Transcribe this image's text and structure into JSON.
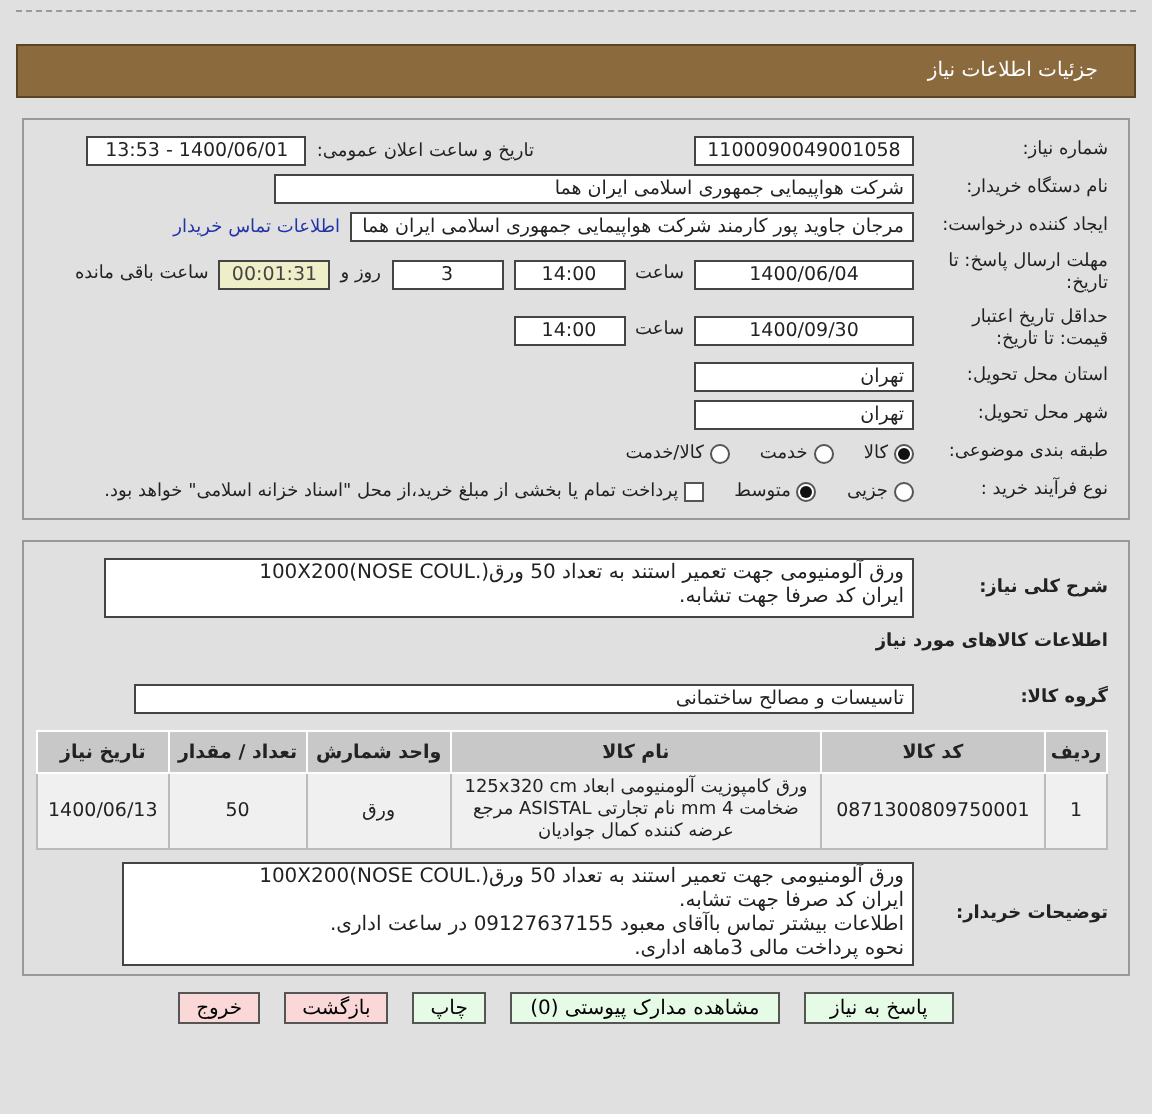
{
  "header": {
    "title": "جزئیات اطلاعات نیاز"
  },
  "need_number": {
    "label": "شماره نیاز:",
    "value": "1100090049001058"
  },
  "announce": {
    "label": "تاريخ و ساعت اعلان عمومی:",
    "value": "1400/06/01 - 13:53"
  },
  "buyer": {
    "label": "نام دستگاه خریدار:",
    "value": "شرکت هواپیمایی جمهوری اسلامی ایران هما"
  },
  "creator": {
    "label": "ایجاد کننده درخواست:",
    "value": "مرجان جاوید پور کارمند شرکت هواپیمایی جمهوری اسلامی ایران هما",
    "link": "اطلاعات تماس خریدار"
  },
  "deadline": {
    "label": "مهلت ارسال پاسخ: تا تاریخ:",
    "date": "1400/06/04",
    "time_label": "ساعت",
    "time": "14:00",
    "days": "3",
    "days_label": "روز و",
    "remaining": "00:01:31",
    "remaining_label": "ساعت باقی مانده"
  },
  "validity": {
    "label": "حداقل تاریخ اعتبار قیمت: تا تاریخ:",
    "date": "1400/09/30",
    "time_label": "ساعت",
    "time": "14:00"
  },
  "province": {
    "label": "استان محل تحویل:",
    "value": "تهران"
  },
  "city": {
    "label": "شهر محل تحویل:",
    "value": "تهران"
  },
  "category": {
    "label": "طبقه بندی موضوعی:",
    "options": [
      {
        "label": "کالا",
        "selected": true
      },
      {
        "label": "خدمت",
        "selected": false
      },
      {
        "label": "کالا/خدمت",
        "selected": false
      }
    ]
  },
  "purchase_type": {
    "label": "نوع فرآیند خرید :",
    "options": [
      {
        "label": "جزیی",
        "selected": false
      },
      {
        "label": "متوسط",
        "selected": true
      }
    ],
    "payment": {
      "label": "پرداخت تمام یا بخشی از مبلغ خرید،از محل \"اسناد خزانه اسلامی\" خواهد بود.",
      "checked": false
    }
  },
  "description": {
    "label": "شرح کلی نیاز:",
    "lines": [
      "ورق آلومنیومی جهت تعمیر استند  به تعداد 50 ورق(.100X200(NOSE COUL",
      "ایران کد صرفا جهت تشابه."
    ]
  },
  "goods_title": "اطلاعات کالاهای مورد نیاز",
  "goods_group": {
    "label": "گروه کالا:",
    "value": "تاسیسات و مصالح ساختمانی"
  },
  "table": {
    "columns": [
      "ردیف",
      "کد کالا",
      "نام کالا",
      "واحد شمارش",
      "تعداد / مقدار",
      "تاریخ نیاز"
    ],
    "rows": [
      [
        "1",
        "0871300809750001",
        "ورق کامپوزیت آلومنیومی ابعاد 125x320 cm ضخامت 4 mm نام تجارتی ASISTAL مرجع عرضه کننده کمال جوادیان",
        "ورق",
        "50",
        "1400/06/13"
      ]
    ]
  },
  "buyer_notes": {
    "label": "توضیحات خریدار:",
    "lines": [
      "ورق آلومنیومی جهت تعمیر استند  به تعداد 50 ورق(.100X200(NOSE COUL",
      "ایران کد صرفا جهت تشابه.",
      "اطلاعات بیشتر تماس باآقای معبود 09127637155 در ساعت اداری.",
      "نحوه پرداخت مالی 3ماهه اداری."
    ]
  },
  "buttons": [
    {
      "label": "پاسخ به نیاز",
      "kind": "action"
    },
    {
      "label": "مشاهده مدارک پیوستی (0)",
      "kind": "action"
    },
    {
      "label": "چاپ",
      "kind": "action"
    },
    {
      "label": "بازگشت",
      "kind": "exit"
    },
    {
      "label": "خروج",
      "kind": "exit"
    }
  ]
}
